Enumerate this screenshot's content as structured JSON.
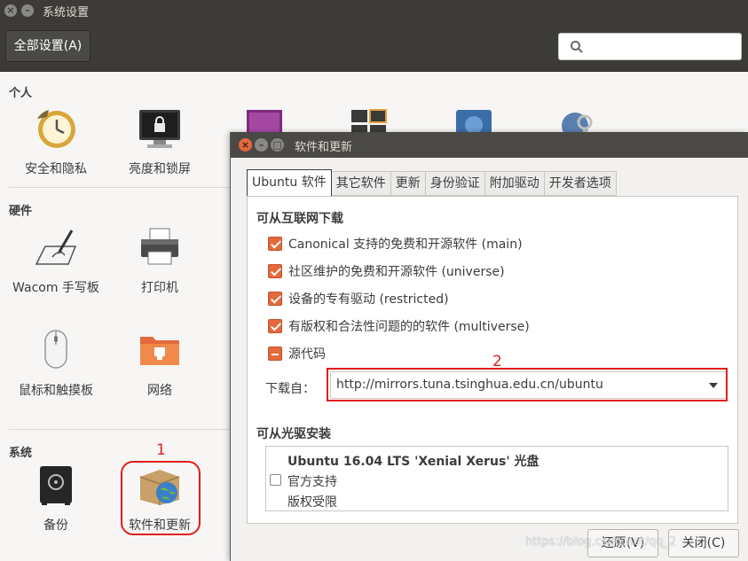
{
  "window": {
    "title": "系统设置",
    "close_glyph": "×",
    "min_glyph": "–"
  },
  "toolbar": {
    "all_settings_label": "全部设置(A)",
    "search_placeholder": ""
  },
  "sections": {
    "personal": {
      "label": "个人",
      "items": [
        {
          "label": "安全和隐私",
          "icon": "clock-security-icon"
        },
        {
          "label": "亮度和锁屏",
          "icon": "monitor-lock-icon"
        },
        {
          "label": "",
          "icon": "purple-app-icon"
        },
        {
          "label": "",
          "icon": "workspace-icon"
        },
        {
          "label": "",
          "icon": "blue-app-icon"
        },
        {
          "label": "",
          "icon": "key-globe-icon"
        }
      ]
    },
    "hardware": {
      "label": "硬件",
      "items": [
        {
          "label": "Wacom 手写板",
          "icon": "tablet-pen-icon"
        },
        {
          "label": "打印机",
          "icon": "printer-icon"
        },
        {
          "label": "鼠标和触摸板",
          "icon": "mouse-icon"
        },
        {
          "label": "网络",
          "icon": "network-folder-icon"
        }
      ]
    },
    "system": {
      "label": "系统",
      "items": [
        {
          "label": "备份",
          "icon": "safe-icon"
        },
        {
          "label": "软件和更新",
          "icon": "software-box-globe-icon"
        }
      ]
    }
  },
  "annotations": {
    "num1": "1",
    "num2": "2",
    "color": "#e21d1d"
  },
  "dialog": {
    "title": "软件和更新",
    "close_glyph": "×",
    "min_glyph": "–",
    "max_glyph": "□",
    "tabs": [
      {
        "label": "Ubuntu 软件",
        "active": true
      },
      {
        "label": "其它软件",
        "active": false
      },
      {
        "label": "更新",
        "active": false
      },
      {
        "label": "身份验证",
        "active": false
      },
      {
        "label": "附加驱动",
        "active": false
      },
      {
        "label": "开发者选项",
        "active": false
      }
    ],
    "internet_group": {
      "title": "可从互联网下载",
      "options": [
        {
          "label": "Canonical 支持的免费和开源软件 (main)",
          "state": "checked"
        },
        {
          "label": "社区维护的免费和开源软件 (universe)",
          "state": "checked"
        },
        {
          "label": "设备的专有驱动 (restricted)",
          "state": "checked"
        },
        {
          "label": "有版权和合法性问题的的软件 (multiverse)",
          "state": "checked"
        },
        {
          "label": "源代码",
          "state": "mixed"
        }
      ]
    },
    "download_from": {
      "label": "下载自：",
      "value": "http://mirrors.tuna.tsinghua.edu.cn/ubuntu"
    },
    "cdrom_group": {
      "title": "可从光驱安装",
      "disc_title": "Ubuntu 16.04 LTS 'Xenial Xerus' 光盘",
      "lines": [
        "官方支持",
        "版权受限"
      ],
      "checked": false
    },
    "buttons": {
      "revert": "还原(V)",
      "close": "关闭(C)"
    },
    "accent_color": "#e4693c"
  },
  "watermark": "https://blog.csdn.net/qq_2"
}
